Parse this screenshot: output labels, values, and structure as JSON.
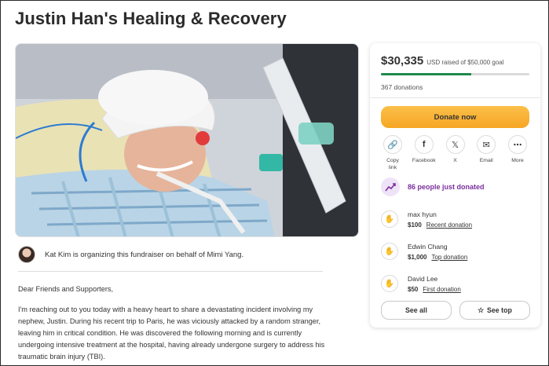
{
  "page": {
    "title": "Justin Han's Healing & Recovery"
  },
  "organizer": {
    "text": "Kat Kim is organizing this fundraiser on behalf of Mimi Yang."
  },
  "story": {
    "greeting": "Dear Friends and Supporters,",
    "paragraph1": "I'm reaching out to you today with a heavy heart to share a devastating incident involving my nephew, Justin. During his recent trip to Paris, he was viciously attacked by a random stranger, leaving him in critical condition. He was discovered the following morning and is currently undergoing intensive treatment at the hospital, having already undergone surgery to address his traumatic brain injury (TBI)."
  },
  "donation_card": {
    "raised_amount": "$30,335",
    "goal_text": "USD raised of $50,000 goal",
    "progress_fraction": 0.6067,
    "donation_count": "367 donations",
    "donate_label": "Donate now",
    "share": [
      {
        "label": "Copy link",
        "icon": "link-icon",
        "glyph": "🔗"
      },
      {
        "label": "Facebook",
        "icon": "facebook-icon",
        "glyph": "f"
      },
      {
        "label": "X",
        "icon": "x-icon",
        "glyph": "𝕏"
      },
      {
        "label": "Email",
        "icon": "email-icon",
        "glyph": "✉"
      },
      {
        "label": "More",
        "icon": "more-icon",
        "glyph": "⋯"
      }
    ],
    "trending_text": "86 people just donated",
    "donors": [
      {
        "name": "max hyun",
        "amount": "$100",
        "tag": "Recent donation"
      },
      {
        "name": "Edwin Chang",
        "amount": "$1,000",
        "tag": "Top donation"
      },
      {
        "name": "David Lee",
        "amount": "$50",
        "tag": "First donation"
      }
    ],
    "see_all_label": "See all",
    "see_top_label": "See top"
  },
  "colors": {
    "progress": "#1f8a4c",
    "donate_button": "#f6a623",
    "trending_text": "#7a2f9c"
  }
}
